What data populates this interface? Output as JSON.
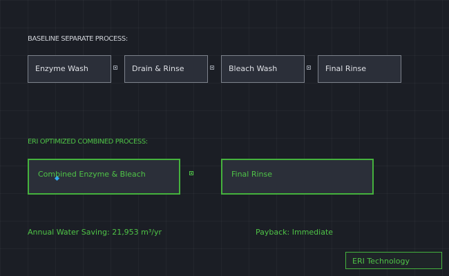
{
  "baseline": {
    "title": "BASELINE SEPARATE PROCESS:",
    "steps": [
      "Enzyme Wash",
      "Drain & Rinse",
      "Bleach Wash",
      "Final Rinse"
    ]
  },
  "optimized": {
    "title": "ERI OPTIMIZED COMBINED PROCESS:",
    "steps": [
      "Combined Enzyme & Bleach",
      "Final Rinse"
    ]
  },
  "results": {
    "water_saving": "Annual Water Saving: 21,953 m³/yr",
    "payback": "Payback: Immediate"
  },
  "badge": {
    "label": "ERI Technology"
  },
  "colors": {
    "background": "#1b1e25",
    "box_fill": "#2b2f39",
    "box_border": "#7e838d",
    "accent_green": "#4fc447",
    "marker_blue": "#33aaee"
  }
}
